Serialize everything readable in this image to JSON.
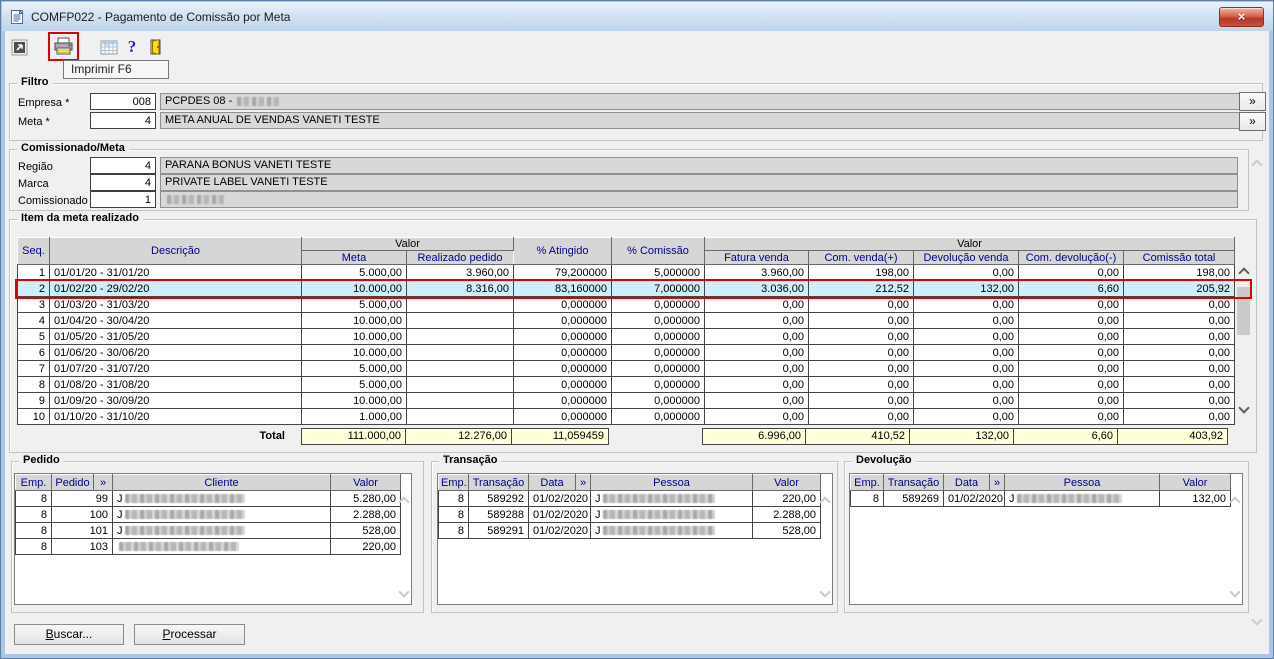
{
  "window": {
    "title": "COMFP022 - Pagamento de Comissão por Meta",
    "close_glyph": "×"
  },
  "toolbar": {
    "tooltip": "Imprimir F6",
    "help_glyph": "?",
    "icons": [
      "detach-icon",
      "print-icon",
      "calendar-icon",
      "help-icon",
      "exit-door-icon"
    ]
  },
  "filtro": {
    "legend": "Filtro",
    "fields": [
      {
        "label": "Empresa *",
        "code": "008",
        "description": "PCPDES 08 - ",
        "more_label": "»"
      },
      {
        "label": "Meta *",
        "code": "4",
        "description": "META ANUAL DE VENDAS VANETI TESTE",
        "more_label": "»"
      }
    ]
  },
  "comissionado_meta": {
    "legend": "Comissionado/Meta",
    "fields": [
      {
        "label": "Região",
        "code": "4",
        "description": "PARANA BONUS VANETI TESTE"
      },
      {
        "label": "Marca",
        "code": "4",
        "description": "PRIVATE LABEL VANETI TESTE"
      },
      {
        "label": "Comissionado",
        "code": "1",
        "description": ""
      }
    ]
  },
  "item_meta": {
    "legend": "Item da meta realizado",
    "headers": {
      "seq": "Seq.",
      "descricao": "Descrição",
      "valor_group_left": "Valor",
      "meta": "Meta",
      "realizado_pedido": "Realizado pedido",
      "atingido": "% Atingido",
      "comissao": "% Comissão",
      "valor_group_right": "Valor",
      "fatura_venda": "Fatura venda",
      "com_venda": "Com. venda(+)",
      "devolucao_venda": "Devolução venda",
      "com_devolucao": "Com. devolução(-)",
      "comissao_total": "Comissão total"
    },
    "selected_index": 1,
    "rows": [
      [
        "1",
        "01/01/20 - 31/01/20",
        "5.000,00",
        "3.960,00",
        "79,200000",
        "5,000000",
        "3.960,00",
        "198,00",
        "0,00",
        "0,00",
        "198,00"
      ],
      [
        "2",
        "01/02/20 - 29/02/20",
        "10.000,00",
        "8.316,00",
        "83,160000",
        "7,000000",
        "3.036,00",
        "212,52",
        "132,00",
        "6,60",
        "205,92"
      ],
      [
        "3",
        "01/03/20 - 31/03/20",
        "5.000,00",
        "",
        "0,000000",
        "0,000000",
        "0,00",
        "0,00",
        "0,00",
        "0,00",
        "0,00"
      ],
      [
        "4",
        "01/04/20 - 30/04/20",
        "10.000,00",
        "",
        "0,000000",
        "0,000000",
        "0,00",
        "0,00",
        "0,00",
        "0,00",
        "0,00"
      ],
      [
        "5",
        "01/05/20 - 31/05/20",
        "10.000,00",
        "",
        "0,000000",
        "0,000000",
        "0,00",
        "0,00",
        "0,00",
        "0,00",
        "0,00"
      ],
      [
        "6",
        "01/06/20 - 30/06/20",
        "10.000,00",
        "",
        "0,000000",
        "0,000000",
        "0,00",
        "0,00",
        "0,00",
        "0,00",
        "0,00"
      ],
      [
        "7",
        "01/07/20 - 31/07/20",
        "5.000,00",
        "",
        "0,000000",
        "0,000000",
        "0,00",
        "0,00",
        "0,00",
        "0,00",
        "0,00"
      ],
      [
        "8",
        "01/08/20 - 31/08/20",
        "5.000,00",
        "",
        "0,000000",
        "0,000000",
        "0,00",
        "0,00",
        "0,00",
        "0,00",
        "0,00"
      ],
      [
        "9",
        "01/09/20 - 30/09/20",
        "10.000,00",
        "",
        "0,000000",
        "0,000000",
        "0,00",
        "0,00",
        "0,00",
        "0,00",
        "0,00"
      ],
      [
        "10",
        "01/10/20 - 31/10/20",
        "1.000,00",
        "",
        "0,000000",
        "0,000000",
        "0,00",
        "0,00",
        "0,00",
        "0,00",
        "0,00"
      ]
    ],
    "total": {
      "label": "Total",
      "meta": "111.000,00",
      "realizado_pedido": "12.276,00",
      "atingido": "11,059459",
      "fatura_venda": "6.996,00",
      "com_venda": "410,52",
      "devolucao_venda": "132,00",
      "com_devolucao": "6,60",
      "comissao_total": "403,92"
    }
  },
  "pedido": {
    "legend": "Pedido",
    "headers": [
      "Emp.",
      "Pedido",
      "»",
      "Cliente",
      "Valor"
    ],
    "rows": [
      [
        "8",
        "99",
        {
          "redacted": true,
          "prefix": "J"
        },
        "5.280,00"
      ],
      [
        "8",
        "100",
        {
          "redacted": true,
          "prefix": "J"
        },
        "2.288,00"
      ],
      [
        "8",
        "101",
        {
          "redacted": true,
          "prefix": "J"
        },
        "528,00"
      ],
      [
        "8",
        "103",
        {
          "redacted": true
        },
        "220,00"
      ]
    ]
  },
  "transacao": {
    "legend": "Transação",
    "headers": [
      "Emp.",
      "Transação",
      "Data",
      "»",
      "Pessoa",
      "Valor"
    ],
    "rows": [
      [
        "8",
        "589292",
        "01/02/2020",
        {
          "redacted": true,
          "prefix": "J"
        },
        "220,00"
      ],
      [
        "8",
        "589288",
        "01/02/2020",
        {
          "redacted": true,
          "prefix": "J"
        },
        "2.288,00"
      ],
      [
        "8",
        "589291",
        "01/02/2020",
        {
          "redacted": true,
          "prefix": "J"
        },
        "528,00"
      ]
    ]
  },
  "devolucao": {
    "legend": "Devolução",
    "headers": [
      "Emp.",
      "Transação",
      "Data",
      "»",
      "Pessoa",
      "Valor"
    ],
    "rows": [
      [
        "8",
        "589269",
        "01/02/2020",
        {
          "redacted": true,
          "prefix": "J"
        },
        "132,00"
      ]
    ]
  },
  "actions": {
    "buscar": "Buscar...",
    "processar": "Processar"
  },
  "colors": {
    "selected_row_bg": "#cdeefb",
    "selected_row_border": "#e10000",
    "total_row_bg": "#ffffd9",
    "header_text": "#00008b",
    "titlebar": "#d3e2f2"
  }
}
